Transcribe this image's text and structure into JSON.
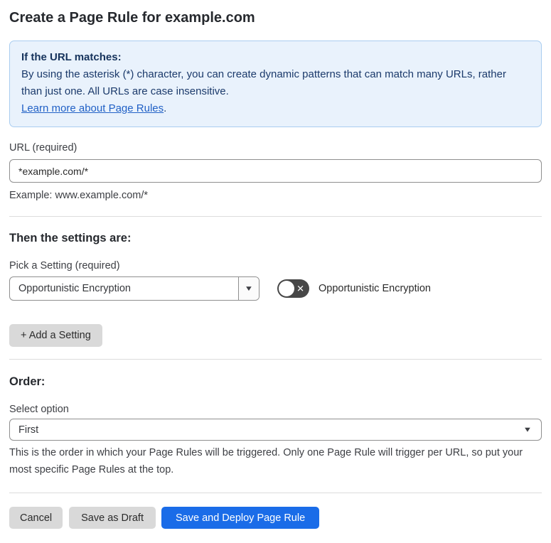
{
  "page": {
    "title": "Create a Page Rule for example.com"
  },
  "info_box": {
    "heading": "If the URL matches:",
    "body": "By using the asterisk (*) character, you can create dynamic patterns that can match many URLs, rather than just one. All URLs are case insensitive.",
    "link": "Learn more about Page Rules",
    "link_suffix": "."
  },
  "url_field": {
    "label": "URL (required)",
    "value": "*example.com/*",
    "helper": "Example: www.example.com/*"
  },
  "settings_section": {
    "heading": "Then the settings are:",
    "picker_label": "Pick a Setting (required)",
    "picker_value": "Opportunistic Encryption",
    "toggle_label": "Opportunistic Encryption",
    "toggle_state": "off",
    "add_setting_button": "+ Add a Setting"
  },
  "order_section": {
    "heading": "Order:",
    "select_label": "Select option",
    "select_value": "First",
    "helper": "This is the order in which your Page Rules will be triggered. Only one Page Rule will trigger per URL, so put your most specific Page Rules at the top."
  },
  "footer": {
    "cancel": "Cancel",
    "save_draft": "Save as Draft",
    "save_deploy": "Save and Deploy Page Rule"
  },
  "icons": {
    "dropdown_arrow": "▼",
    "toggle_off_x": "✕"
  },
  "colors": {
    "info_bg": "#e9f2fc",
    "info_border": "#a9cdf0",
    "info_text": "#1b3a6b",
    "link": "#2161c6",
    "primary_button": "#1a6ce8",
    "gray_button": "#d9d9d9",
    "toggle_off_bg": "#474747"
  }
}
